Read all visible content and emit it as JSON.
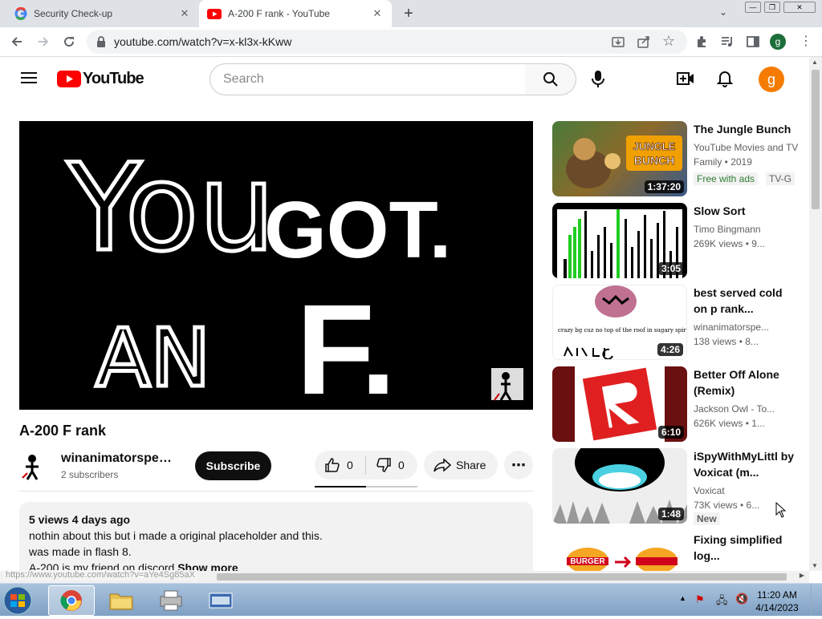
{
  "browser": {
    "tabs": [
      {
        "title": "Security Check-up",
        "active": false
      },
      {
        "title": "A-200 F rank - YouTube",
        "active": true
      }
    ],
    "url": "youtube.com/watch?v=x-kl3x-kKww",
    "status_url": "https://www.youtube.com/watch?v=aYe4Sg85aX"
  },
  "youtube": {
    "logo_text": "YouTube",
    "search_placeholder": "Search",
    "avatar_letter": "g",
    "profile_letter": "g"
  },
  "player": {
    "text_you": "You",
    "text_got": "GOT.",
    "text_an": "AN",
    "text_f": "F."
  },
  "video": {
    "title": "A-200 F rank",
    "channel": "winanimatorspeedrun",
    "subscribers": "2 subscribers",
    "subscribe_label": "Subscribe",
    "likes": "0",
    "dislikes": "0",
    "share_label": "Share",
    "views_date": "5 views  4 days ago",
    "description_lines": [
      "nothin about this but i made a original placeholder and this.",
      "was made in flash 8.",
      "A-200 is my friend on discord"
    ],
    "show_more": "Show more"
  },
  "recommendations": [
    {
      "title": "The Jungle Bunch",
      "meta1": "YouTube Movies and TV",
      "meta2": "Family • 2019",
      "badges": [
        "Free with ads",
        "TV-G"
      ],
      "duration": "1:37:20",
      "thumb_text": "THE JUNGLE BUNCH"
    },
    {
      "title": "Slow Sort",
      "meta1": "Timo Bingmann",
      "meta2": "269K views  • 9...",
      "badges": [],
      "duration": "3:05"
    },
    {
      "title": "best served cold on p rank...",
      "meta1": "winanimatorspe...",
      "meta2": "138 views  • 8...",
      "badges": [],
      "duration": "4:26",
      "thumb_text": "crazy bg cuz no top of the roof in sugary spire so for now its just coneball and the music"
    },
    {
      "title": "Better Off Alone (Remix)",
      "meta1": "Jackson Owl - To...",
      "meta2": "626K views  • 1...",
      "badges": [],
      "duration": "6:10"
    },
    {
      "title": "iSpyWithMyLittl by Voxicat (m...",
      "meta1": "Voxicat",
      "meta2": "73K views  • 6...",
      "badges": [
        "New"
      ],
      "duration": "1:48"
    },
    {
      "title": "Fixing simplified log...",
      "meta1": "",
      "meta2": "",
      "badges": [],
      "duration": "",
      "thumb_text": "BURGER"
    }
  ],
  "taskbar": {
    "time": "11:20 AM",
    "date": "4/14/2023"
  },
  "colors": {
    "yt_red": "#ff0000",
    "avatar_orange": "#f57c00",
    "chrome_tabstrip": "#dee1e6",
    "badge_green": "#2e7d32"
  }
}
